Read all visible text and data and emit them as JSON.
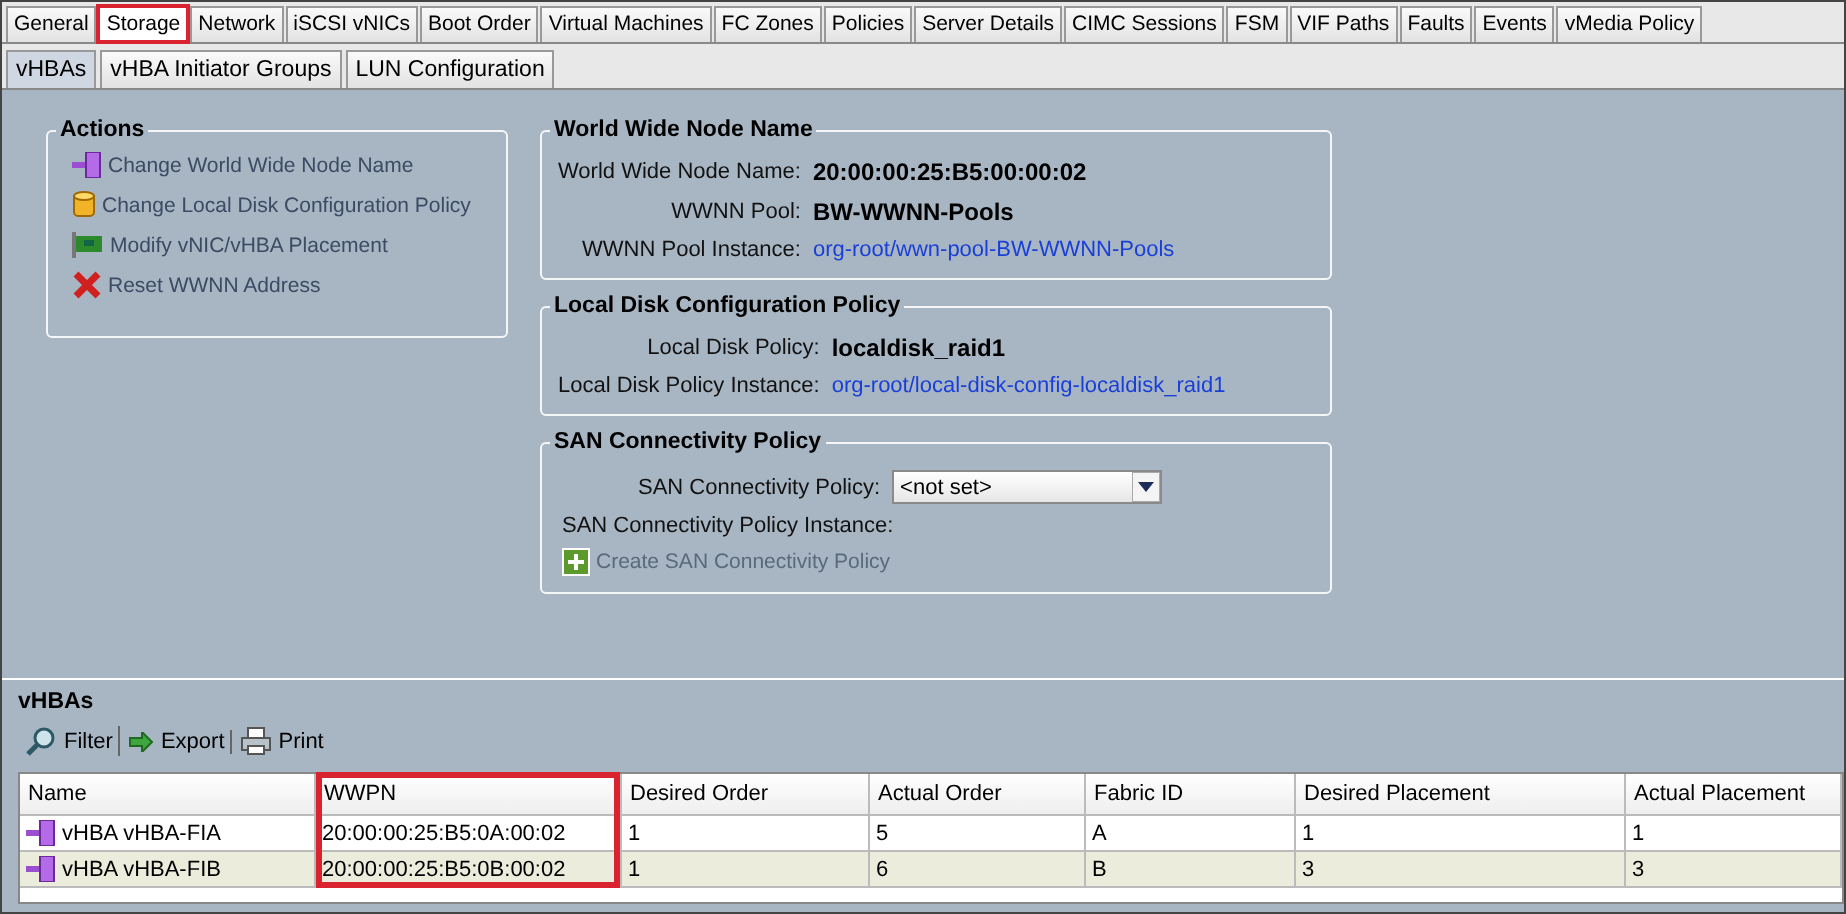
{
  "tabs": [
    {
      "label": "General",
      "selected": false,
      "highlighted": false
    },
    {
      "label": "Storage",
      "selected": true,
      "highlighted": true
    },
    {
      "label": "Network",
      "selected": false,
      "highlighted": false
    },
    {
      "label": "iSCSI vNICs",
      "selected": false,
      "highlighted": false
    },
    {
      "label": "Boot Order",
      "selected": false,
      "highlighted": false
    },
    {
      "label": "Virtual Machines",
      "selected": false,
      "highlighted": false
    },
    {
      "label": "FC Zones",
      "selected": false,
      "highlighted": false
    },
    {
      "label": "Policies",
      "selected": false,
      "highlighted": false
    },
    {
      "label": "Server Details",
      "selected": false,
      "highlighted": false
    },
    {
      "label": "CIMC Sessions",
      "selected": false,
      "highlighted": false
    },
    {
      "label": "FSM",
      "selected": false,
      "highlighted": false
    },
    {
      "label": "VIF Paths",
      "selected": false,
      "highlighted": false
    },
    {
      "label": "Faults",
      "selected": false,
      "highlighted": false
    },
    {
      "label": "Events",
      "selected": false,
      "highlighted": false
    },
    {
      "label": "vMedia Policy",
      "selected": false,
      "highlighted": false
    }
  ],
  "subtabs": [
    {
      "label": "vHBAs",
      "selected": true
    },
    {
      "label": "vHBA Initiator Groups",
      "selected": false
    },
    {
      "label": "LUN Configuration",
      "selected": false
    }
  ],
  "actions": {
    "title": "Actions",
    "items": [
      {
        "kind": "vhba",
        "label": "Change World Wide Node Name"
      },
      {
        "kind": "disk",
        "label": "Change Local Disk Configuration Policy"
      },
      {
        "kind": "card",
        "label": "Modify vNIC/vHBA Placement"
      },
      {
        "kind": "reset",
        "label": "Reset WWNN Address"
      }
    ]
  },
  "wwnn": {
    "title": "World Wide Node Name",
    "fields": [
      {
        "kind": "bold",
        "label": "World Wide Node Name:",
        "value": "20:00:00:25:B5:00:00:02"
      },
      {
        "kind": "bold",
        "label": "WWNN Pool:",
        "value": "BW-WWNN-Pools"
      },
      {
        "kind": "link",
        "label": "WWNN Pool Instance:",
        "value": "org-root/wwn-pool-BW-WWNN-Pools"
      }
    ]
  },
  "local_disk": {
    "title": "Local Disk Configuration Policy",
    "fields": [
      {
        "kind": "bold",
        "label": "Local Disk Policy:",
        "value": "localdisk_raid1"
      },
      {
        "kind": "link",
        "label": "Local Disk Policy Instance:",
        "value": "org-root/local-disk-config-localdisk_raid1"
      }
    ]
  },
  "san": {
    "title": "SAN Connectivity Policy",
    "select_label": "SAN Connectivity Policy:",
    "select_value": "<not set>",
    "instance_label": "SAN Connectivity Policy Instance:",
    "create_link": "Create SAN Connectivity Policy"
  },
  "vhbas": {
    "title": "vHBAs",
    "toolbar": [
      {
        "kind": "filter",
        "label": "Filter"
      },
      {
        "kind": "export",
        "label": "Export"
      },
      {
        "kind": "print",
        "label": "Print"
      }
    ],
    "columns": [
      {
        "label": "Name",
        "highlighted": false
      },
      {
        "label": "WWPN",
        "highlighted": true
      },
      {
        "label": "Desired Order",
        "highlighted": false
      },
      {
        "label": "Actual Order",
        "highlighted": false
      },
      {
        "label": "Fabric ID",
        "highlighted": false
      },
      {
        "label": "Desired Placement",
        "highlighted": false
      },
      {
        "label": "Actual Placement",
        "highlighted": false
      }
    ],
    "rows": [
      {
        "selected": false,
        "cells": [
          "vHBA vHBA-FIA",
          "20:00:00:25:B5:0A:00:02",
          "1",
          "5",
          "A",
          "1",
          "1"
        ]
      },
      {
        "selected": true,
        "cells": [
          "vHBA vHBA-FIB",
          "20:00:00:25:B5:0B:00:02",
          "1",
          "6",
          "B",
          "3",
          "3"
        ]
      }
    ]
  }
}
